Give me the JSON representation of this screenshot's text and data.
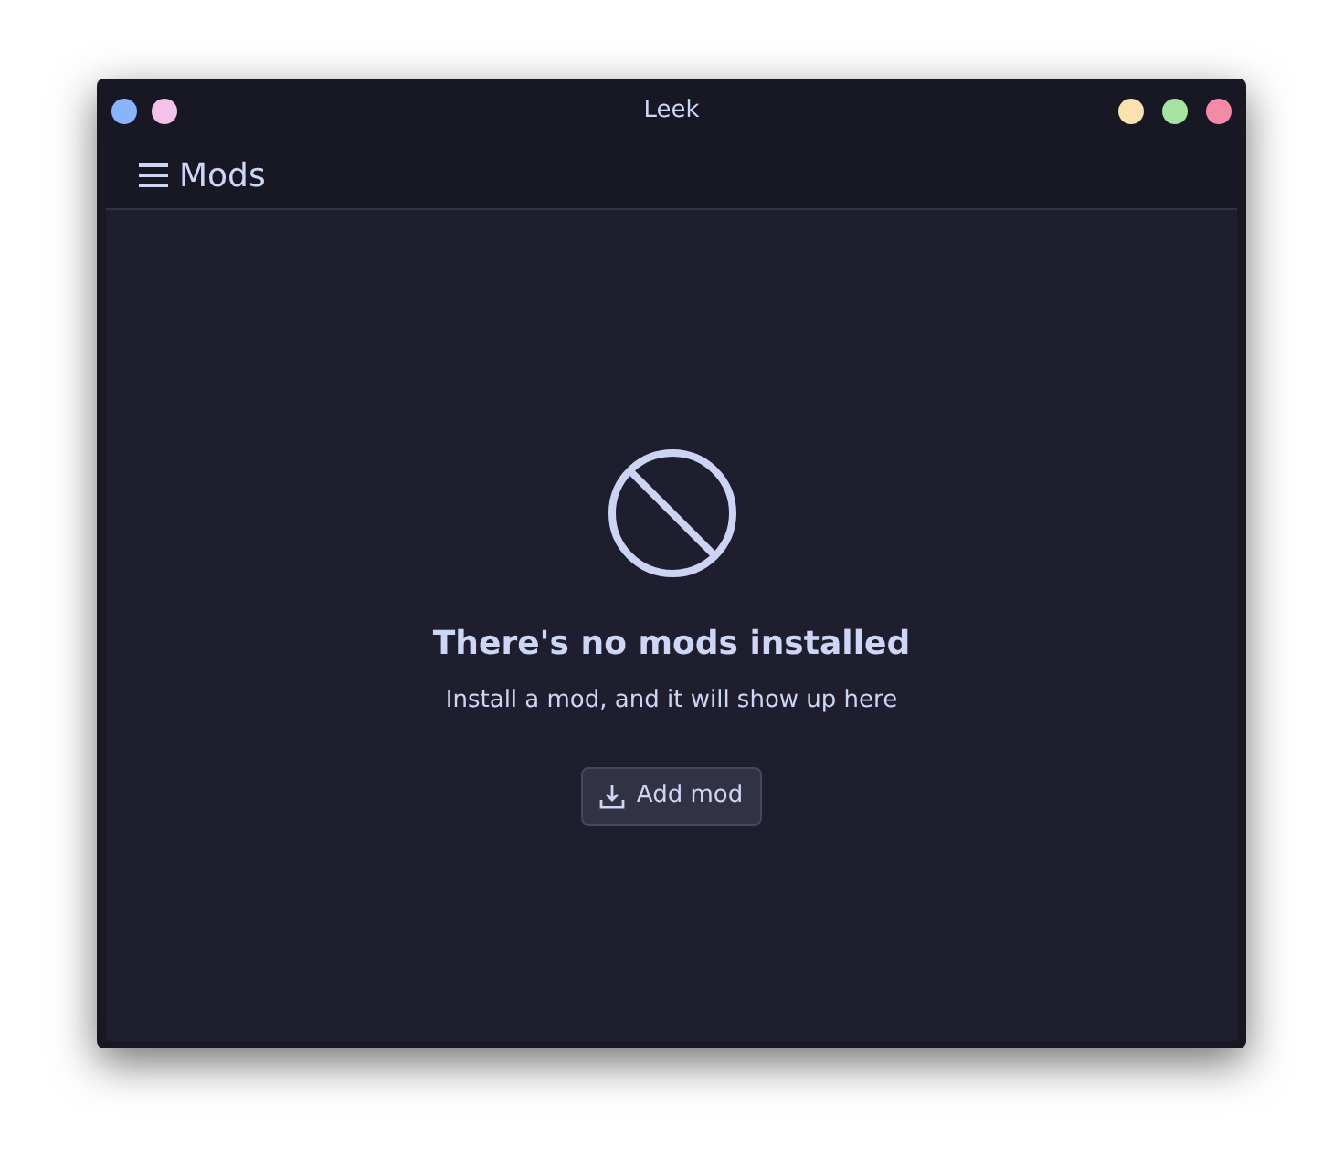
{
  "window": {
    "title": "Leek",
    "left_buttons": [
      {
        "color": "#89b4fa"
      },
      {
        "color": "#f5c2e7"
      }
    ],
    "right_buttons": [
      {
        "color": "#f9e2af"
      },
      {
        "color": "#a6e3a1"
      },
      {
        "color": "#f38ba8"
      }
    ]
  },
  "header": {
    "title": "Mods"
  },
  "empty_state": {
    "heading": "There's no mods installed",
    "message": "Install a mod, and it will show up here",
    "button": "Add mod"
  }
}
